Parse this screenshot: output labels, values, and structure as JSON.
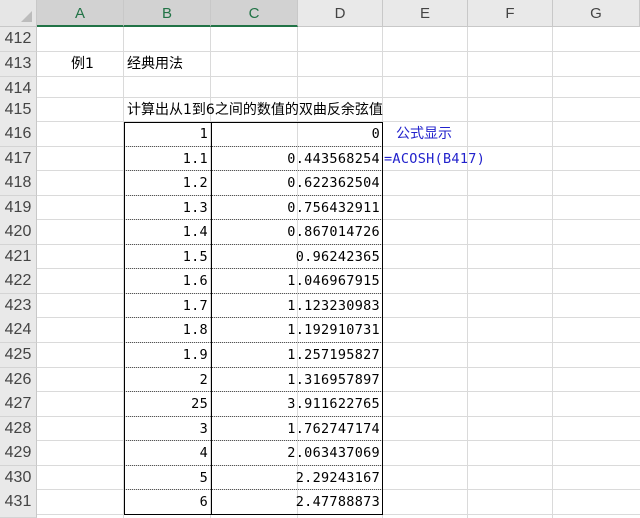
{
  "columns": [
    "A",
    "B",
    "C",
    "D",
    "E",
    "F",
    "G"
  ],
  "selected_columns": [
    "A",
    "B",
    "C"
  ],
  "rows": [
    "412",
    "413",
    "414",
    "415",
    "416",
    "417",
    "418",
    "419",
    "420",
    "421",
    "422",
    "423",
    "424",
    "425",
    "426",
    "427",
    "428",
    "429",
    "430",
    "431"
  ],
  "cells": {
    "a413": "例1",
    "b413": "经典用法",
    "b415": "计算出从1到6之间的数值的双曲反余弦值",
    "e416": "公式显示",
    "e417": "=ACOSH(B417)"
  },
  "table": {
    "b": [
      "1",
      "1.1",
      "1.2",
      "1.3",
      "1.4",
      "1.5",
      "1.6",
      "1.7",
      "1.8",
      "1.9",
      "2",
      "25",
      "3",
      "4",
      "5",
      "6"
    ],
    "d": [
      "0",
      "0.443568254",
      "0.622362504",
      "0.756432911",
      "0.867014726",
      "0.96242365",
      "1.046967915",
      "1.123230983",
      "1.192910731",
      "1.257195827",
      "1.316957897",
      "3.911622765",
      "1.762747174",
      "2.063437069",
      "2.29243167",
      "2.47788873"
    ]
  },
  "colors": {
    "selected_header_text": "#217346",
    "formula_text": "#2222cc"
  }
}
